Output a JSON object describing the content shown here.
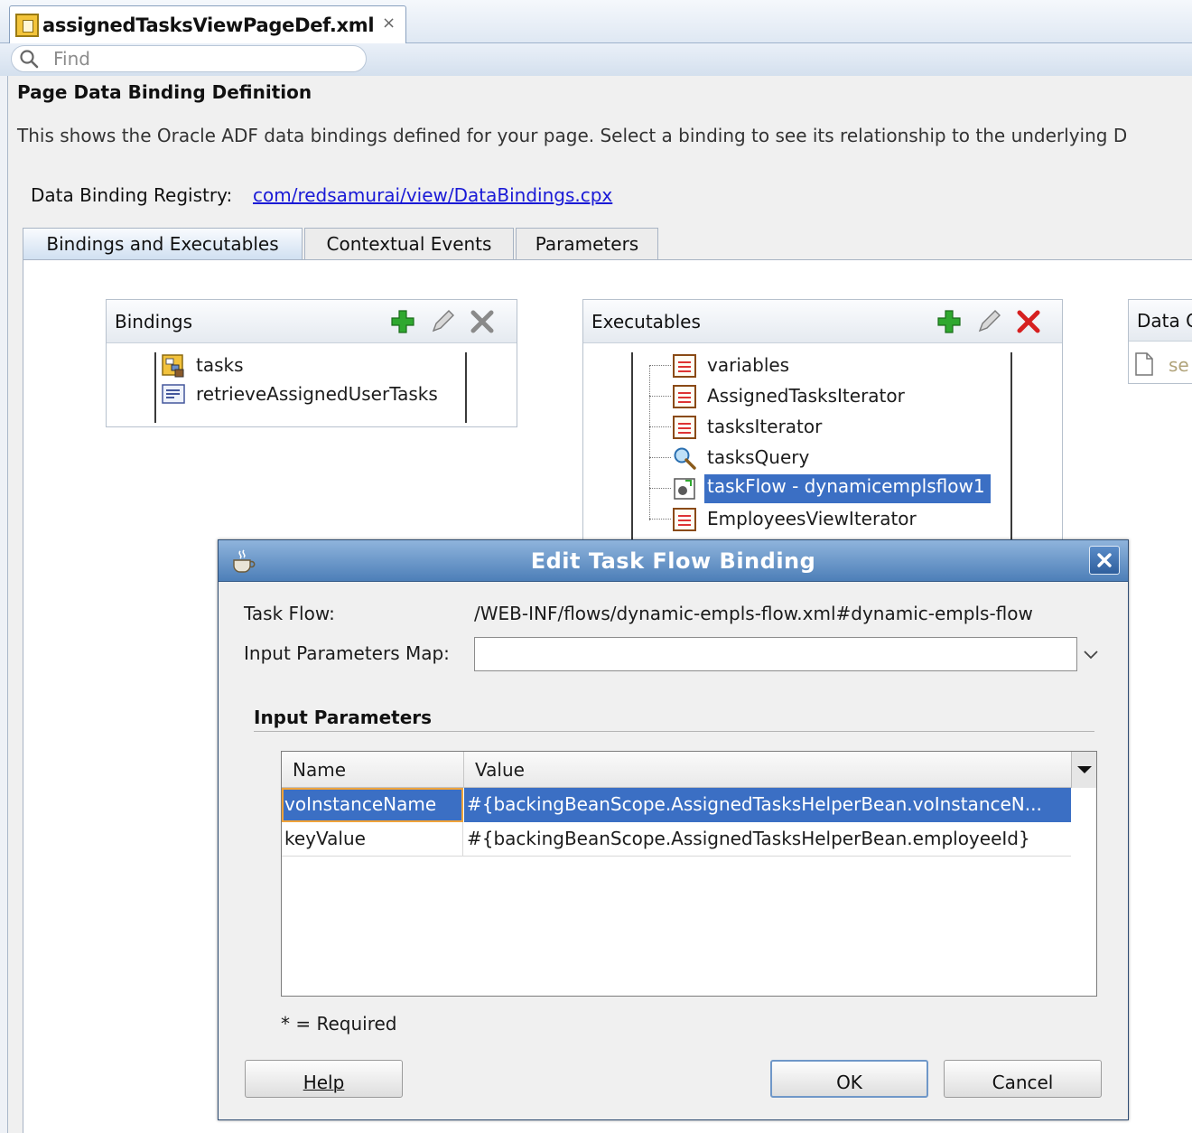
{
  "editor": {
    "file_tab": "assignedTasksViewPageDef.xml",
    "close_glyph": "×",
    "find_placeholder": "Find"
  },
  "page": {
    "title": "Page Data Binding Definition",
    "description": "This shows the Oracle ADF data bindings defined for your page. Select a binding to see its relationship to the underlying D",
    "registry_label": "Data Binding Registry:",
    "registry_link": "com/redsamurai/view/DataBindings.cpx"
  },
  "tabs": [
    "Bindings and Executables",
    "Contextual Events",
    "Parameters"
  ],
  "bindings": {
    "title": "Bindings",
    "items": [
      "tasks",
      "retrieveAssignedUserTasks"
    ]
  },
  "executables": {
    "title": "Executables",
    "items": [
      "variables",
      "AssignedTasksIterator",
      "tasksIterator",
      "tasksQuery",
      "taskFlow - dynamicemplsflow1",
      "EmployeesViewIterator"
    ]
  },
  "data_controls": {
    "title": "Data C",
    "item": "se"
  },
  "dialog": {
    "title": "Edit Task Flow Binding",
    "task_flow_label": "Task Flow:",
    "task_flow_value": "/WEB-INF/flows/dynamic-empls-flow.xml#dynamic-empls-flow",
    "params_map_label": "Input Parameters Map:",
    "section_title": "Input Parameters",
    "columns": [
      "Name",
      "Value"
    ],
    "rows": [
      {
        "name": "voInstanceName",
        "value": "#{backingBeanScope.AssignedTasksHelperBean.voInstanceN..."
      },
      {
        "name": "keyValue",
        "value": "#{backingBeanScope.AssignedTasksHelperBean.employeeId}"
      }
    ],
    "required_note": "* = Required",
    "help": "Help",
    "ok": "OK",
    "cancel": "Cancel"
  },
  "colors": {
    "selection": "#3b6fc4",
    "link": "#1a1ad6",
    "add_green": "#2fa82f",
    "delete_red": "#d62020"
  }
}
